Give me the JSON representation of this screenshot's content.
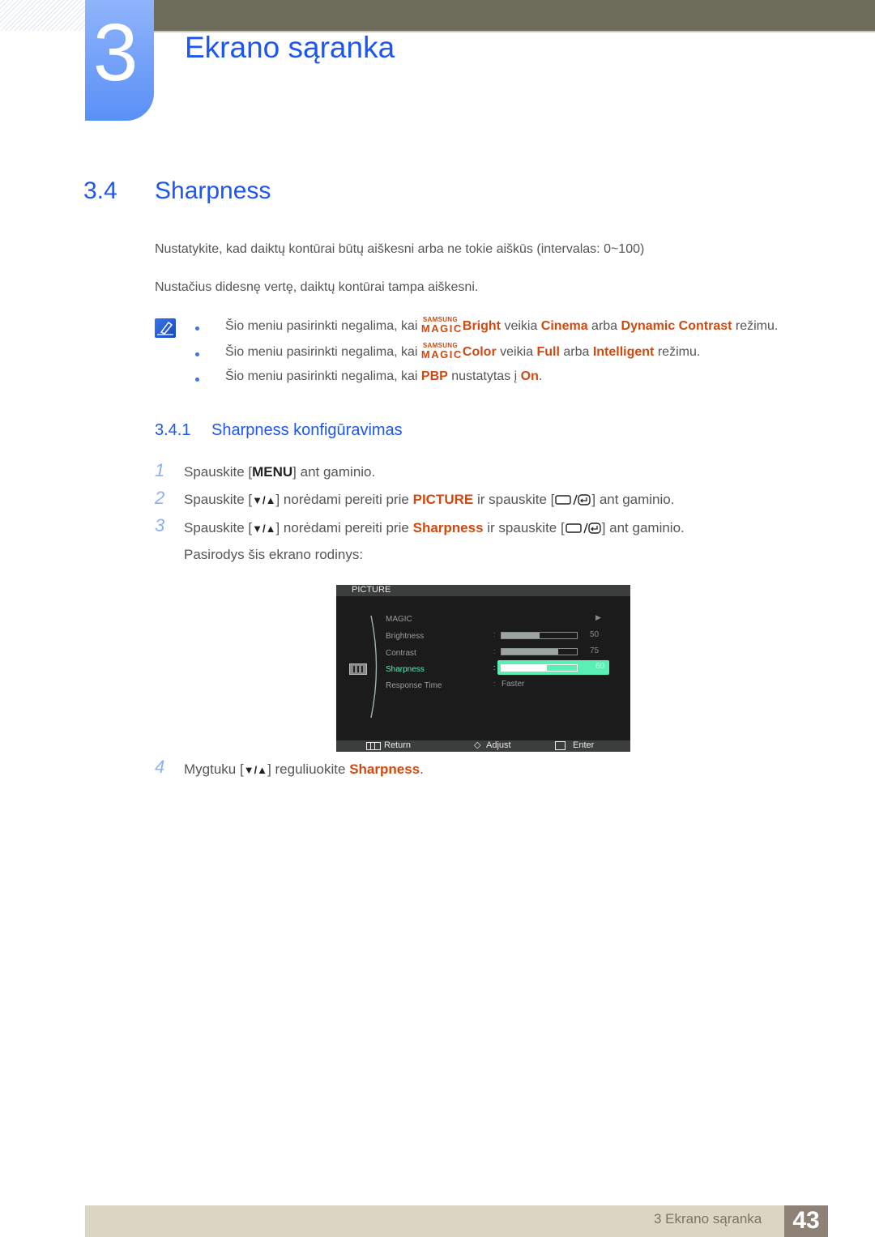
{
  "chapter": {
    "number": "3",
    "title": "Ekrano sąranka"
  },
  "section": {
    "number": "3.4",
    "title": "Sharpness"
  },
  "paragraphs": [
    "Nustatykite, kad daiktų kontūrai būtų aiškesni arba ne tokie aiškūs (intervalas: 0~100)",
    "Nustačius didesnę vertę, daiktų kontūrai tampa aiškesni."
  ],
  "notes": [
    {
      "prefix": "Šio meniu pasirinkti negalima, kai ",
      "magic_top": "SAMSUNG",
      "magic_bottom": "MAGIC",
      "magic_word": "Bright",
      "mid1": " veikia ",
      "hl1": "Cinema",
      "mid2": " arba ",
      "hl2": "Dynamic Contrast",
      "suffix": " režimu."
    },
    {
      "prefix": "Šio meniu pasirinkti negalima, kai ",
      "magic_top": "SAMSUNG",
      "magic_bottom": "MAGIC",
      "magic_word": "Color",
      "mid1": " veikia ",
      "hl1": "Full",
      "mid2": " arba ",
      "hl2": "Intelligent",
      "suffix": " režimu."
    },
    {
      "prefix": "Šio meniu pasirinkti negalima, kai ",
      "hl1": "PBP",
      "mid1": " nustatytas į ",
      "hl2": "On",
      "suffix": "."
    }
  ],
  "subsection": {
    "number": "3.4.1",
    "title": "Sharpness konfigūravimas"
  },
  "steps": [
    {
      "num": "1",
      "a": "Spauskite [",
      "key": "MENU",
      "b": "] ant gaminio."
    },
    {
      "num": "2",
      "a": "Spauskite [",
      "key": "▼/▲",
      "b": "] norėdami pereiti prie ",
      "hl": "PICTURE",
      "c": " ir spauskite [",
      "d": "] ant gaminio."
    },
    {
      "num": "3",
      "a": "Spauskite [",
      "key": "▼/▲",
      "b": "] norėdami pereiti prie ",
      "hl": "Sharpness",
      "c": " ir spauskite [",
      "d": "] ant gaminio."
    },
    {
      "num": "",
      "a": "Pasirodys šis ekrano rodinys:"
    },
    {
      "num": "4",
      "a": "Mygtuku [",
      "key": "▼/▲",
      "b": "] reguliuokite ",
      "hl": "Sharpness",
      "c": "."
    }
  ],
  "osd": {
    "header": "PICTURE",
    "items": [
      {
        "label": "MAGIC",
        "arrow": "▶"
      },
      {
        "label": "Brightness",
        "value": "50",
        "level": 0.5
      },
      {
        "label": "Contrast",
        "value": "75",
        "level": 0.75
      },
      {
        "label": "Sharpness",
        "value": "60",
        "level": 0.6,
        "selected": true
      },
      {
        "label": "Response Time",
        "text_value": "Faster"
      }
    ],
    "footer": {
      "return": "Return",
      "adjust": "Adjust",
      "enter": "Enter"
    },
    "colors": {
      "selected": "#5af0b4"
    }
  },
  "footer": {
    "chapter_text": "3 Ekrano sąranka",
    "page": "43"
  },
  "colors": {
    "heading": "#1d56f0",
    "highlight": "#d04a10",
    "topbar": "#6e6c5a"
  }
}
